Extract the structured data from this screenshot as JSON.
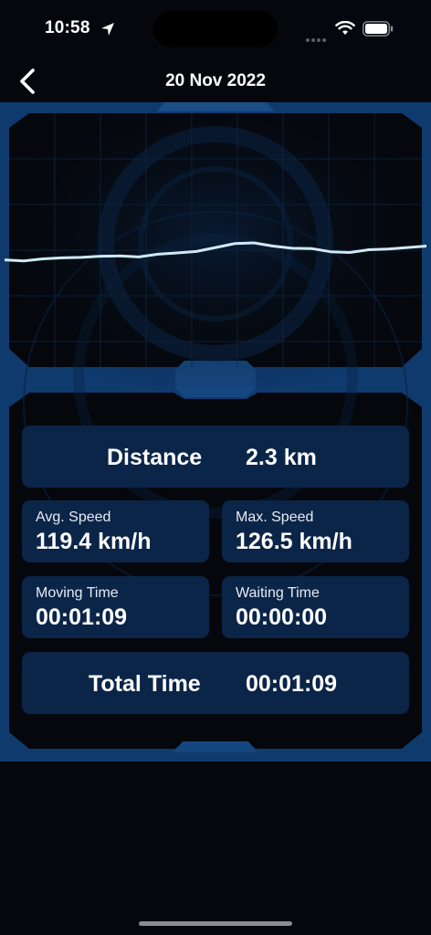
{
  "status_bar": {
    "time": "10:58"
  },
  "header": {
    "title": "20 Nov 2022"
  },
  "chart_data": {
    "type": "line",
    "series": [
      {
        "values": [
          42.0,
          41.6,
          42.4,
          42.8,
          43.0,
          43.5,
          43.6,
          43.2,
          44.3,
          44.8,
          45.4,
          47.0,
          48.6,
          48.9,
          47.6,
          46.7,
          46.6,
          45.3,
          45.0,
          46.1,
          46.4,
          47.0,
          47.6
        ]
      }
    ],
    "color": "#cfeaf6"
  },
  "stats": {
    "distance": {
      "label": "Distance",
      "value": "2.3 km"
    },
    "avg_speed": {
      "label": "Avg. Speed",
      "value": "119.4 km/h"
    },
    "max_speed": {
      "label": "Max. Speed",
      "value": "126.5 km/h"
    },
    "moving_time": {
      "label": "Moving Time",
      "value": "00:01:09"
    },
    "waiting_time": {
      "label": "Waiting Time",
      "value": "00:00:00"
    },
    "total_time": {
      "label": "Total Time",
      "value": "00:01:09"
    }
  },
  "colors": {
    "background": "#05070c",
    "card": "#0b2548",
    "frame": "#0f3a6e",
    "accent_line": "#cfeaf6"
  }
}
